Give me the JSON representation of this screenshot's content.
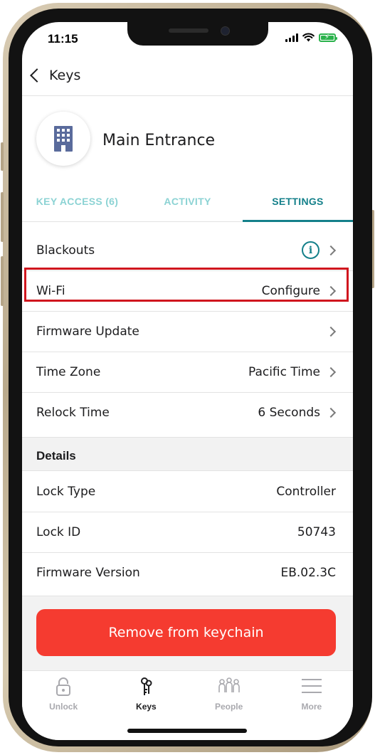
{
  "status_bar": {
    "time": "11:15"
  },
  "nav": {
    "back_label": "Keys"
  },
  "door": {
    "name": "Main Entrance",
    "icon": "building-icon"
  },
  "tabs": [
    {
      "label": "KEY ACCESS (6)",
      "active": false
    },
    {
      "label": "ACTIVITY",
      "active": false
    },
    {
      "label": "SETTINGS",
      "active": true
    }
  ],
  "settings_rows": [
    {
      "label": "Blackouts",
      "value": "",
      "icon": "info-icon"
    },
    {
      "label": "Wi-Fi",
      "value": "Configure",
      "highlighted": true
    },
    {
      "label": "Firmware Update",
      "value": ""
    },
    {
      "label": "Time Zone",
      "value": "Pacific Time"
    },
    {
      "label": "Relock Time",
      "value": "6 Seconds"
    }
  ],
  "details": {
    "title": "Details",
    "rows": [
      {
        "label": "Lock Type",
        "value": "Controller"
      },
      {
        "label": "Lock ID",
        "value": "50743"
      },
      {
        "label": "Firmware Version",
        "value": "EB.02.3C"
      }
    ]
  },
  "remove_button": {
    "label": "Remove from keychain",
    "color": "#f53b30"
  },
  "tab_bar": [
    {
      "label": "Unlock",
      "icon": "padlock-icon",
      "active": false
    },
    {
      "label": "Keys",
      "icon": "key-icon",
      "active": true
    },
    {
      "label": "People",
      "icon": "people-icon",
      "active": false
    },
    {
      "label": "More",
      "icon": "menu-icon",
      "active": false
    }
  ],
  "colors": {
    "accent": "#14808a",
    "accent_light": "#8cd3d4",
    "highlight": "#d0161e",
    "danger": "#f53b30"
  }
}
